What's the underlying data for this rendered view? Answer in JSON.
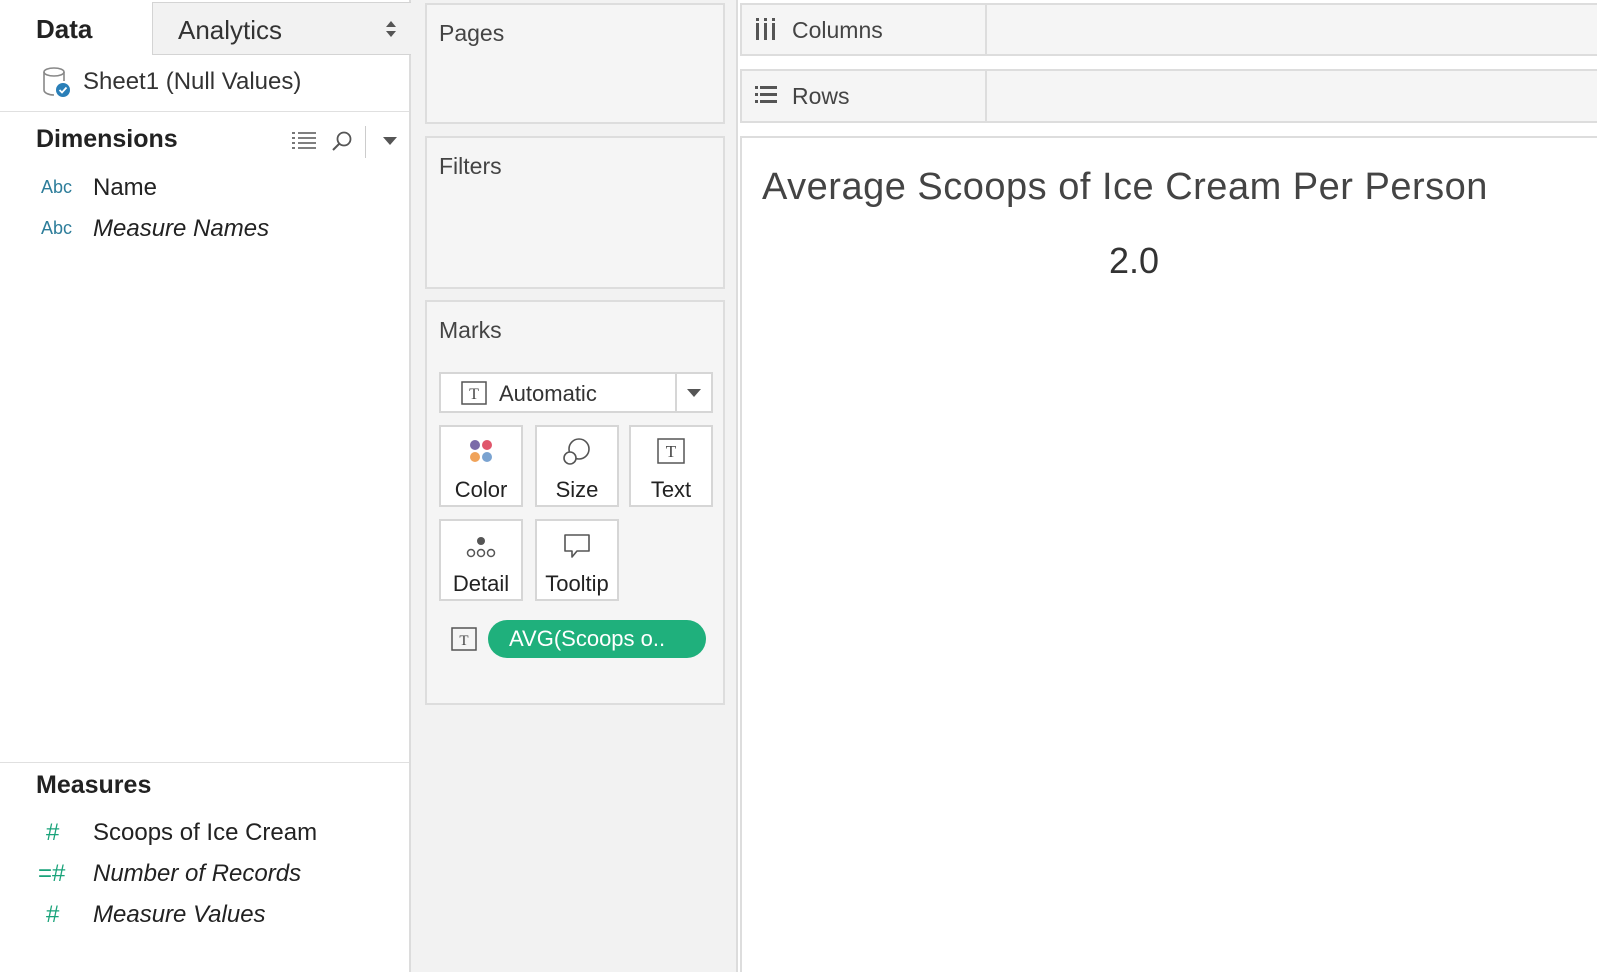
{
  "left_pane": {
    "tabs": {
      "data": "Data",
      "analytics": "Analytics"
    },
    "datasource": "Sheet1 (Null Values)",
    "dimensions": {
      "title": "Dimensions",
      "fields": [
        {
          "type": "Abc",
          "name": "Name",
          "italic": false
        },
        {
          "type": "Abc",
          "name": "Measure Names",
          "italic": true
        }
      ]
    },
    "measures": {
      "title": "Measures",
      "fields": [
        {
          "type": "#",
          "name": "Scoops of Ice Cream",
          "italic": false
        },
        {
          "type": "=#",
          "name": "Number of Records",
          "italic": true
        },
        {
          "type": "#",
          "name": "Measure Values",
          "italic": true
        }
      ]
    }
  },
  "cards": {
    "pages": "Pages",
    "filters": "Filters",
    "marks": {
      "title": "Marks",
      "mark_type": "Automatic",
      "buttons": {
        "color": "Color",
        "size": "Size",
        "text": "Text",
        "detail": "Detail",
        "tooltip": "Tooltip"
      },
      "pill": "AVG(Scoops o.."
    }
  },
  "shelves": {
    "columns": "Columns",
    "rows": "Rows"
  },
  "view": {
    "title": "Average Scoops of Ice Cream Per Person",
    "value": "2.0"
  },
  "colors": {
    "pill": "#1fb07c",
    "dimension_type": "#2d7d9a",
    "measure_type": "#1aa37a"
  }
}
